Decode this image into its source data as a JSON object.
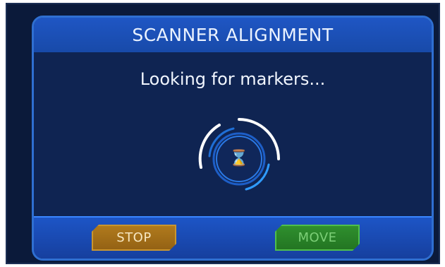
{
  "dialog": {
    "title": "SCANNER ALIGNMENT",
    "status_text": "Looking for markers..."
  },
  "spinner": {
    "icon": "hourglass-icon"
  },
  "buttons": {
    "stop_label": "STOP",
    "move_label": "MOVE"
  },
  "colors": {
    "header_blue": "#1f56c4",
    "panel_navy": "#0f2452",
    "accent_blue": "#3a86ff",
    "stop_orange": "#b07a1d",
    "move_green": "#2f8f2e"
  }
}
